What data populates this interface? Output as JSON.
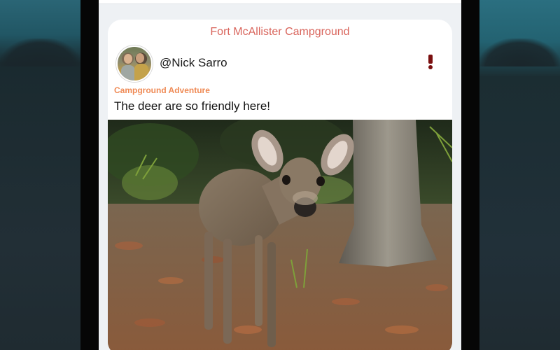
{
  "post": {
    "campground_name": "Fort McAllister Campground",
    "username": "@Nick Sarro",
    "category": "Campground Adventure",
    "caption": "The deer are so friendly here!",
    "report_icon": "exclamation-icon",
    "photo_subject": "deer-photo"
  },
  "colors": {
    "campground_title": "#d9655c",
    "category": "#ef8a55",
    "report_icon": "#7a0f0f"
  }
}
